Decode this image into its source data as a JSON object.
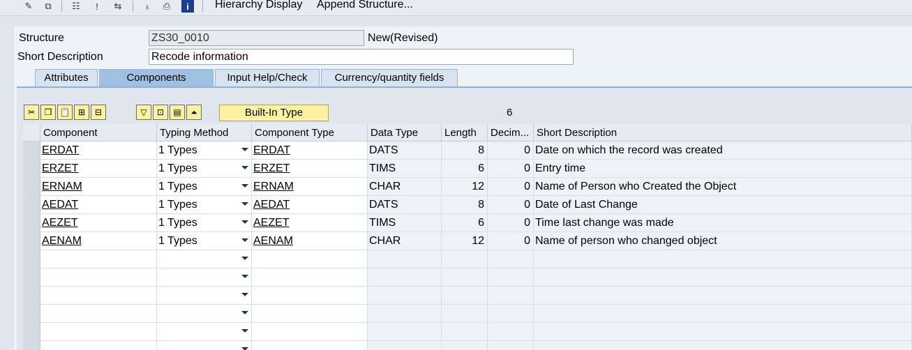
{
  "toolbar": {
    "icons": [
      "pencil-icon",
      "display-change-icon",
      "hierarchy-icon",
      "where-used-icon",
      "navigate-icon",
      "tree-icon",
      "print-icon",
      "info-icon"
    ],
    "hierarchy_display": "Hierarchy Display",
    "append_structure": "Append Structure..."
  },
  "header": {
    "structure_label": "Structure",
    "structure_value": "ZS30_0010",
    "status": "New(Revised)",
    "short_desc_label": "Short Description",
    "short_desc_value": "Recode information"
  },
  "tabs": [
    {
      "label": "Attributes"
    },
    {
      "label": "Components"
    },
    {
      "label": "Input Help/Check"
    },
    {
      "label": "Currency/quantity fields"
    }
  ],
  "grid_toolbar": {
    "builtin_type": "Built-In Type",
    "count": "6"
  },
  "columns": [
    "Component",
    "Typing Method",
    "Component Type",
    "Data Type",
    "Length",
    "Decim...",
    "Short Description"
  ],
  "rows": [
    {
      "component": "ERDAT",
      "typing": "1 Types",
      "comptype": "ERDAT",
      "datatype": "DATS",
      "length": "8",
      "decimals": "0",
      "desc": "Date on which the record was created"
    },
    {
      "component": "ERZET",
      "typing": "1 Types",
      "comptype": "ERZET",
      "datatype": "TIMS",
      "length": "6",
      "decimals": "0",
      "desc": "Entry time"
    },
    {
      "component": "ERNAM",
      "typing": "1 Types",
      "comptype": "ERNAM",
      "datatype": "CHAR",
      "length": "12",
      "decimals": "0",
      "desc": "Name of Person who Created the Object"
    },
    {
      "component": "AEDAT",
      "typing": "1 Types",
      "comptype": "AEDAT",
      "datatype": "DATS",
      "length": "8",
      "decimals": "0",
      "desc": "Date of Last Change"
    },
    {
      "component": "AEZET",
      "typing": "1 Types",
      "comptype": "AEZET",
      "datatype": "TIMS",
      "length": "6",
      "decimals": "0",
      "desc": "Time last change was made"
    },
    {
      "component": "AENAM",
      "typing": "1 Types",
      "comptype": "AENAM",
      "datatype": "CHAR",
      "length": "12",
      "decimals": "0",
      "desc": "Name of person who changed object"
    }
  ]
}
